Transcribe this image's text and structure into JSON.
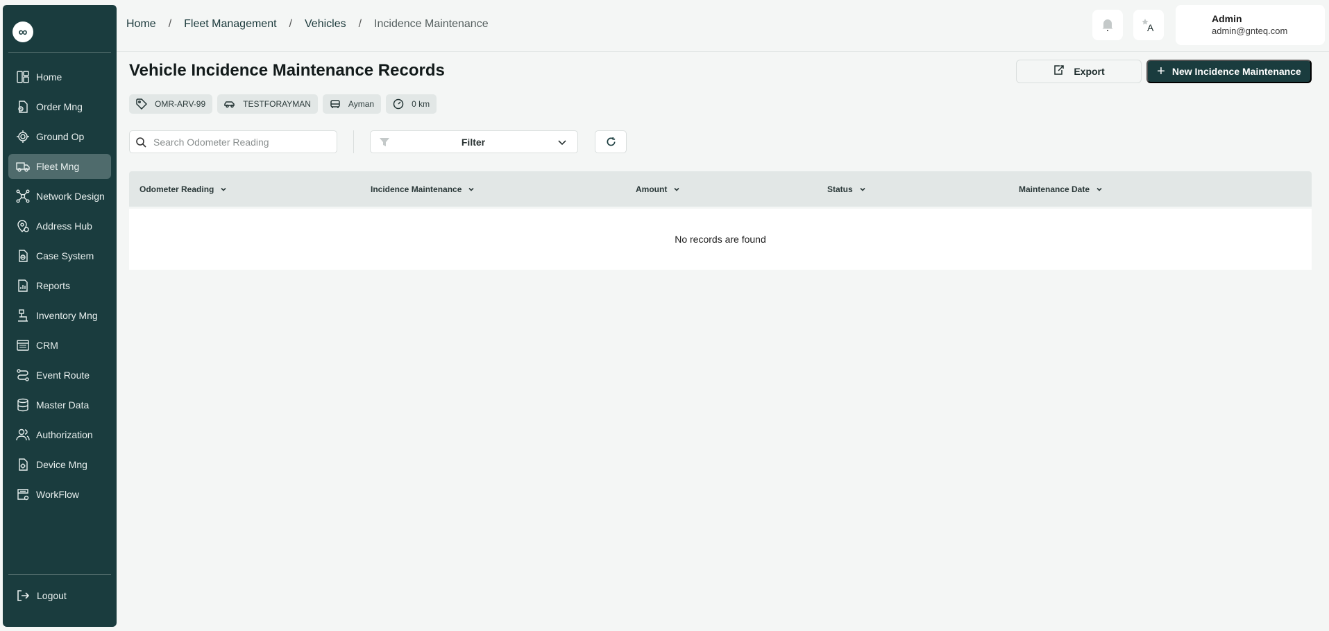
{
  "sidebar": {
    "logo": "∞",
    "items": [
      {
        "label": "Home",
        "icon": "dashboard-icon"
      },
      {
        "label": "Order Mng",
        "icon": "order-icon"
      },
      {
        "label": "Ground Op",
        "icon": "ground-op-icon"
      },
      {
        "label": "Fleet Mng",
        "icon": "truck-icon",
        "active": true
      },
      {
        "label": "Network Design",
        "icon": "network-icon"
      },
      {
        "label": "Address Hub",
        "icon": "location-pin-icon"
      },
      {
        "label": "Case System",
        "icon": "case-icon"
      },
      {
        "label": "Reports",
        "icon": "report-icon"
      },
      {
        "label": "Inventory Mng",
        "icon": "inventory-icon"
      },
      {
        "label": "CRM",
        "icon": "crm-icon"
      },
      {
        "label": "Event Route",
        "icon": "route-icon"
      },
      {
        "label": "Master Data",
        "icon": "database-icon"
      },
      {
        "label": "Authorization",
        "icon": "users-icon"
      },
      {
        "label": "Device Mng",
        "icon": "device-icon"
      },
      {
        "label": "WorkFlow",
        "icon": "workflow-icon"
      }
    ],
    "logout": "Logout"
  },
  "breadcrumb": [
    "Home",
    "Fleet Management",
    "Vehicles",
    "Incidence Maintenance"
  ],
  "breadcrumb_separator": "/",
  "user": {
    "name": "Admin",
    "email": "admin@gnteq.com"
  },
  "page": {
    "title": "Vehicle Incidence Maintenance Records",
    "export_label": "Export",
    "new_label": "New Incidence Maintenance",
    "new_icon": "+"
  },
  "chips": [
    {
      "icon": "tag-icon",
      "text": "OMR-ARV-99"
    },
    {
      "icon": "car-icon",
      "text": "TESTFORAYMAN"
    },
    {
      "icon": "driver-seat-icon",
      "text": "Ayman"
    },
    {
      "icon": "speedometer-icon",
      "text": "0 km"
    }
  ],
  "search": {
    "placeholder": "Search Odometer Reading",
    "value": ""
  },
  "filter": {
    "label": "Filter"
  },
  "table": {
    "columns": [
      "Odometer Reading",
      "Incidence Maintenance",
      "Amount",
      "Status",
      "Maintenance Date"
    ],
    "empty_message": "No records are found"
  },
  "colors": {
    "brand": "#1a3c3e",
    "active_nav": "#4f6b6c",
    "background": "#f4f6f5"
  }
}
